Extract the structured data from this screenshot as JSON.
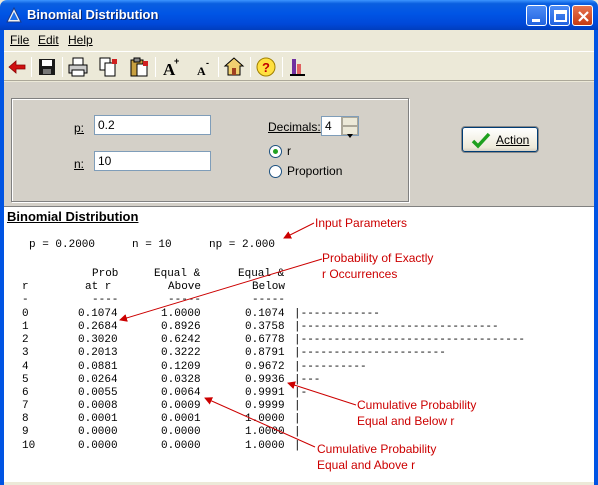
{
  "window": {
    "title": "Binomial Distribution"
  },
  "menu": {
    "file": "File",
    "edit": "Edit",
    "help": "Help"
  },
  "toolbar_icons": [
    "back-arrow-icon",
    "save-icon",
    "print-icon",
    "copy-icon",
    "paste-icon",
    "font-increase-icon",
    "font-decrease-icon",
    "home-icon",
    "help-icon",
    "stats-icon"
  ],
  "params": {
    "p_label": "p:",
    "p_value": "0.2",
    "n_label": "n:",
    "n_value": "10",
    "decimals_label": "Decimals:",
    "decimals_value": "4",
    "radio_r": "r",
    "radio_proportion": "Proportion",
    "selected": "r"
  },
  "action_label": "Action",
  "output": {
    "heading": "Binomial Distribution",
    "summary": {
      "p": "p = 0.2000",
      "n": "n = 10",
      "np": "np = 2.000"
    },
    "header1": {
      "prob": "Prob",
      "equal_above": "Equal &",
      "equal_below": "Equal &"
    },
    "header2": {
      "r": "r",
      "prob": "at r",
      "equal_above": "Above",
      "equal_below": "Below"
    },
    "dashes": {
      "r": "-",
      "prob": "----",
      "equal_above": "-----",
      "equal_below": "-----"
    },
    "rows": [
      {
        "r": "0",
        "prob": "0.1074",
        "above": "1.0000",
        "below": "0.1074",
        "bar": "|------------"
      },
      {
        "r": "1",
        "prob": "0.2684",
        "above": "0.8926",
        "below": "0.3758",
        "bar": "|------------------------------"
      },
      {
        "r": "2",
        "prob": "0.3020",
        "above": "0.6242",
        "below": "0.6778",
        "bar": "|----------------------------------"
      },
      {
        "r": "3",
        "prob": "0.2013",
        "above": "0.3222",
        "below": "0.8791",
        "bar": "|----------------------"
      },
      {
        "r": "4",
        "prob": "0.0881",
        "above": "0.1209",
        "below": "0.9672",
        "bar": "|----------"
      },
      {
        "r": "5",
        "prob": "0.0264",
        "above": "0.0328",
        "below": "0.9936",
        "bar": "|---"
      },
      {
        "r": "6",
        "prob": "0.0055",
        "above": "0.0064",
        "below": "0.9991",
        "bar": "|-"
      },
      {
        "r": "7",
        "prob": "0.0008",
        "above": "0.0009",
        "below": "0.9999",
        "bar": "|"
      },
      {
        "r": "8",
        "prob": "0.0001",
        "above": "0.0001",
        "below": "1.0000",
        "bar": "|"
      },
      {
        "r": "9",
        "prob": "0.0000",
        "above": "0.0000",
        "below": "1.0000",
        "bar": "|"
      },
      {
        "r": "10",
        "prob": "0.0000",
        "above": "0.0000",
        "below": "1.0000",
        "bar": "|"
      }
    ]
  },
  "annotations": {
    "input_params": "Input Parameters",
    "prob_exact_1": "Probability of Exactly",
    "prob_exact_2": "r Occurrences",
    "cum_below_1": "Cumulative  Probability",
    "cum_below_2": "Equal and Below r",
    "cum_above_1": "Cumulative  Probability",
    "cum_above_2": "Equal and Above r"
  },
  "colors": {
    "annotation": "#cc0000",
    "title_bar": "#0055e5",
    "panel": "#d4d0c8"
  }
}
